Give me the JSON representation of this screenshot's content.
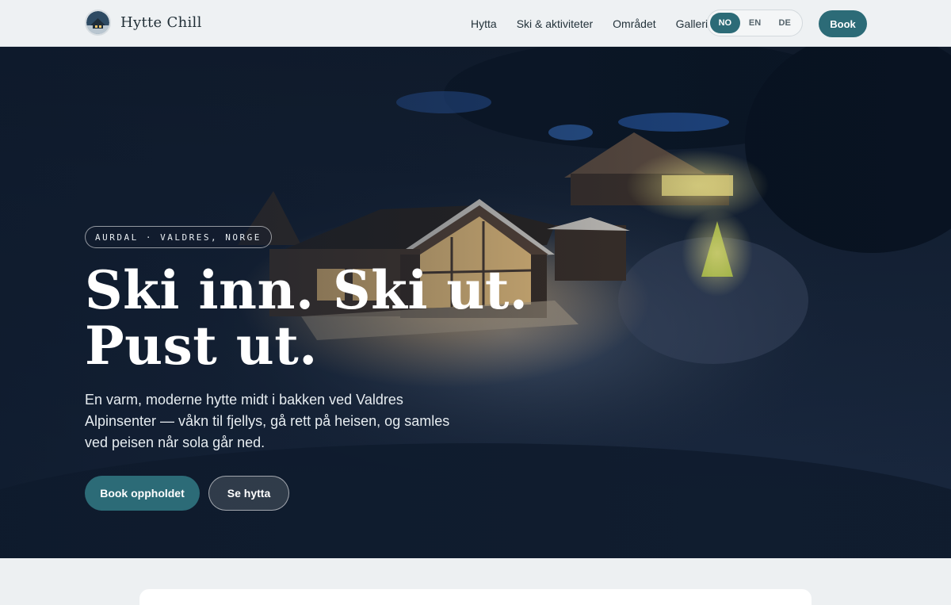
{
  "header": {
    "brand": "Hytte Chill",
    "nav": [
      "Hytta",
      "Ski & aktiviteter",
      "Området",
      "Galleri"
    ],
    "languages": [
      "NO",
      "EN",
      "DE"
    ],
    "active_language": "NO",
    "book_label": "Book"
  },
  "hero": {
    "location": "AURDAL · VALDRES, NORGE",
    "title_line1": "Ski inn. Ski ut.",
    "title_line2": "Pust ut.",
    "text": "En varm, moderne hytte midt i bakken ved Valdres Alpinsenter — våkn til fjellys, gå rett på heisen, og samles ved peisen når sola går ned.",
    "primary_cta": "Book oppholdet",
    "secondary_cta": "Se hytta"
  },
  "colors": {
    "accent": "#2c6b77",
    "background": "#edf0f2"
  }
}
